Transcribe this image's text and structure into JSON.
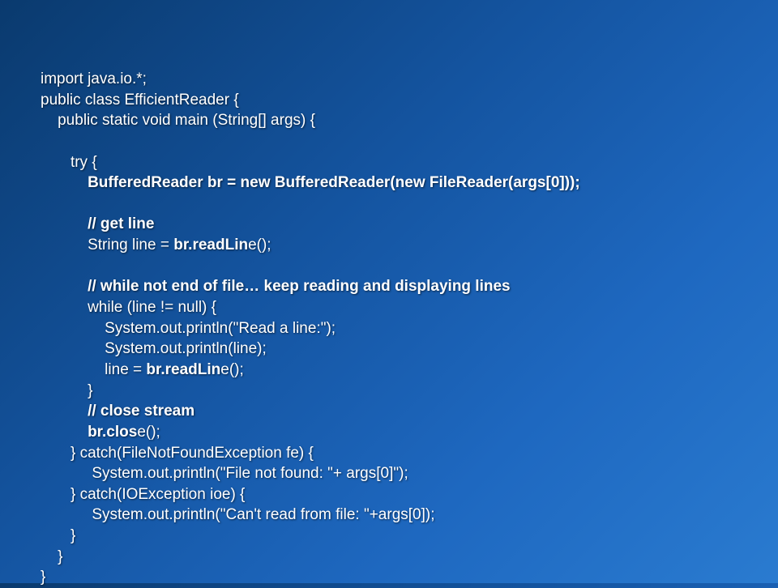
{
  "code": {
    "l1": "import java.io.*;",
    "l2": "public class EfficientReader {",
    "l3": "    public static void main (String[] args) {",
    "l4": "       try {",
    "l5a": "           ",
    "l5b": "BufferedReader br = new BufferedReader(new FileReader(args[0]));",
    "l6a": "           ",
    "l6b": "// get line",
    "l7a": "           String line = ",
    "l7b": "br.readLin",
    "l7c": "e();",
    "l8a": "           ",
    "l8b": "// while not end of file… keep reading and displaying lines",
    "l9": "           while (line != null) {",
    "l10": "               System.out.println(\"Read a line:\");",
    "l11": "               System.out.println(line);",
    "l12a": "               line = ",
    "l12b": "br.readLin",
    "l12c": "e();",
    "l13": "           }",
    "l14a": "           ",
    "l14b": "// close stream",
    "l15a": "           ",
    "l15b": "br.clos",
    "l15c": "e();",
    "l16": "       } catch(FileNotFoundException fe) {",
    "l17": "            System.out.println(\"File not found: \"+ args[0]\");",
    "l18": "       } catch(IOException ioe) {",
    "l19": "            System.out.println(\"Can't read from file: \"+args[0]);",
    "l20": "       }",
    "l21": "    }",
    "l22": "}"
  }
}
